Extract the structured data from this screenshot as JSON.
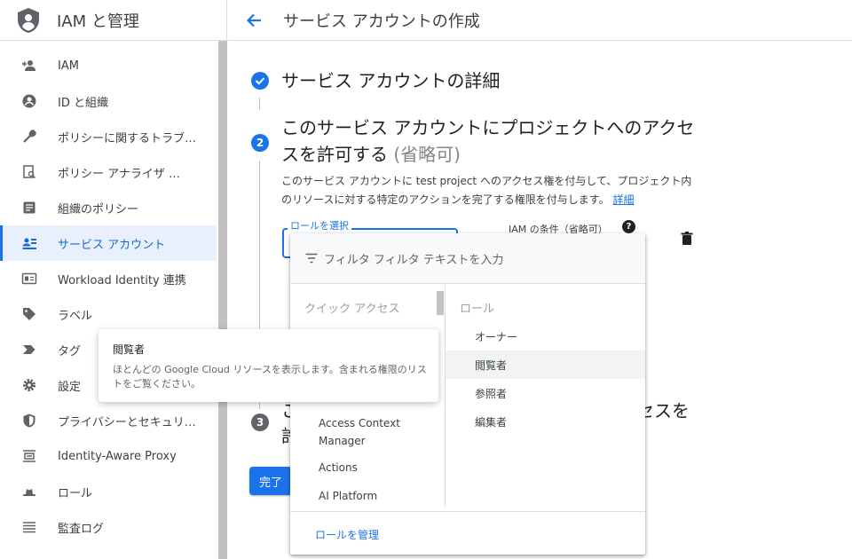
{
  "sidebar": {
    "title": "IAM と管理",
    "items": [
      {
        "label": "IAM",
        "icon": "person-add-icon"
      },
      {
        "label": "ID と組織",
        "icon": "account-circle-icon"
      },
      {
        "label": "ポリシーに関するトラブ…",
        "icon": "wrench-icon"
      },
      {
        "label": "ポリシー アナライザ …",
        "icon": "policy-analyzer-icon"
      },
      {
        "label": "組織のポリシー",
        "icon": "document-icon"
      },
      {
        "label": "サービス アカウント",
        "icon": "service-account-icon",
        "active": true
      },
      {
        "label": "Workload Identity 連携",
        "icon": "id-card-icon"
      },
      {
        "label": "ラベル",
        "icon": "label-icon"
      },
      {
        "label": "タグ",
        "icon": "tag-chevron-icon"
      },
      {
        "label": "設定",
        "icon": "gear-icon"
      },
      {
        "label": "プライバシーとセキュリ…",
        "icon": "shield-icon"
      },
      {
        "label": "Identity-Aware Proxy",
        "icon": "proxy-icon"
      },
      {
        "label": "ロール",
        "icon": "hat-icon"
      },
      {
        "label": "監査ログ",
        "icon": "list-icon"
      }
    ]
  },
  "header": {
    "title": "サービス アカウントの作成"
  },
  "steps": {
    "step1": {
      "title": "サービス アカウントの詳細"
    },
    "step2": {
      "number": "2",
      "title_line1": "このサービス アカウントにプロジェクトへのアクセ",
      "title_line2": "スを許可する",
      "title_optional": "(省略可)",
      "description": "このサービス アカウントに test project へのアクセス権を付与して、プロジェクト内のリソースに対する特定のアクションを完了する権限を付与します。",
      "details_link": "詳細"
    },
    "step3": {
      "number": "3",
      "title_fragment": "セスを"
    }
  },
  "role_field": {
    "label": "ロールを選択"
  },
  "iam_condition": {
    "label": "IAM の条件（省略可）"
  },
  "done_button": {
    "label": "完了"
  },
  "dropdown": {
    "filter_placeholder": "フィルタ フィルタ テキストを入力",
    "left_header": "クイック アクセス",
    "left_items": [
      "Access Context Manager",
      "Actions",
      "AI Platform"
    ],
    "right_header": "ロール",
    "right_items": [
      "オーナー",
      "閲覧者",
      "参照者",
      "編集者"
    ],
    "highlighted_index": 1,
    "manage_roles": "ロールを管理"
  },
  "tooltip": {
    "title": "閲覧者",
    "description": "ほとんどの Google Cloud リソースを表示します。含まれる権限のリストをご覧ください。"
  },
  "colors": {
    "accent": "#1a73e8",
    "active_bg": "#e8f0fe"
  }
}
